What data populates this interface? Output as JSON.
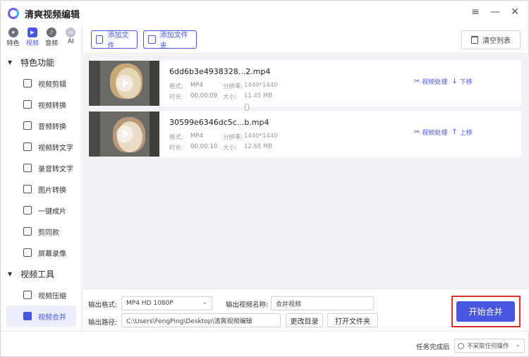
{
  "app": {
    "title": "清爽视频编辑"
  },
  "window_controls": [
    "≡",
    "—",
    "✕"
  ],
  "category_tabs": [
    {
      "label": "特色",
      "icon": "star-icon"
    },
    {
      "label": "视频",
      "icon": "video-icon"
    },
    {
      "label": "音频",
      "icon": "audio-icon"
    },
    {
      "label": "AI",
      "icon": "ai-icon"
    }
  ],
  "sidebar": {
    "groups": [
      {
        "title": "特色功能",
        "items": [
          "视频剪辑",
          "视频转换",
          "音频转换",
          "视频转文字",
          "录音转文字",
          "图片转换",
          "一键成片",
          "剪同款",
          "屏幕录像"
        ]
      },
      {
        "title": "视频工具",
        "items": [
          "视频压缩",
          "视频合并"
        ]
      }
    ],
    "active_item": "视频合并"
  },
  "toolbar": {
    "add_file": "添加文件",
    "add_folder": "添加文件夹",
    "clear_list": "清空列表"
  },
  "files": [
    {
      "name": "6dd6b3e4938328...2.mp4",
      "format_label": "格式:",
      "format": "MP4",
      "resolution_label": "分辨率:",
      "resolution": "1440*1440",
      "duration_label": "时长:",
      "duration": "00:00:09",
      "size_label": "大小:",
      "size": "11.45 MB",
      "process": "视频处理",
      "move": "下移",
      "move_arrow": "↓"
    },
    {
      "name": "30599e6346dc5c...b.mp4",
      "format_label": "格式:",
      "format": "MP4",
      "resolution_label": "分辨率:",
      "resolution": "1440*1440",
      "duration_label": "时长:",
      "duration": "00:00:10",
      "size_label": "大小:",
      "size": "12.68 MB",
      "process": "视频处理",
      "move": "上移",
      "move_arrow": "↑"
    }
  ],
  "settings": {
    "format_label": "输出格式:",
    "format_value": "MP4  HD 1080P",
    "name_label": "输出视频名称:",
    "name_value": "合并视频",
    "path_label": "输出路径:",
    "path_value": "C:\\Users\\FengPing\\Desktop\\清爽视频编辑",
    "change_dir": "更改目录",
    "open_folder": "打开文件夹",
    "start": "开始合并"
  },
  "status": {
    "after_label": "任务完成后",
    "after_value": "不采取任何操作"
  }
}
